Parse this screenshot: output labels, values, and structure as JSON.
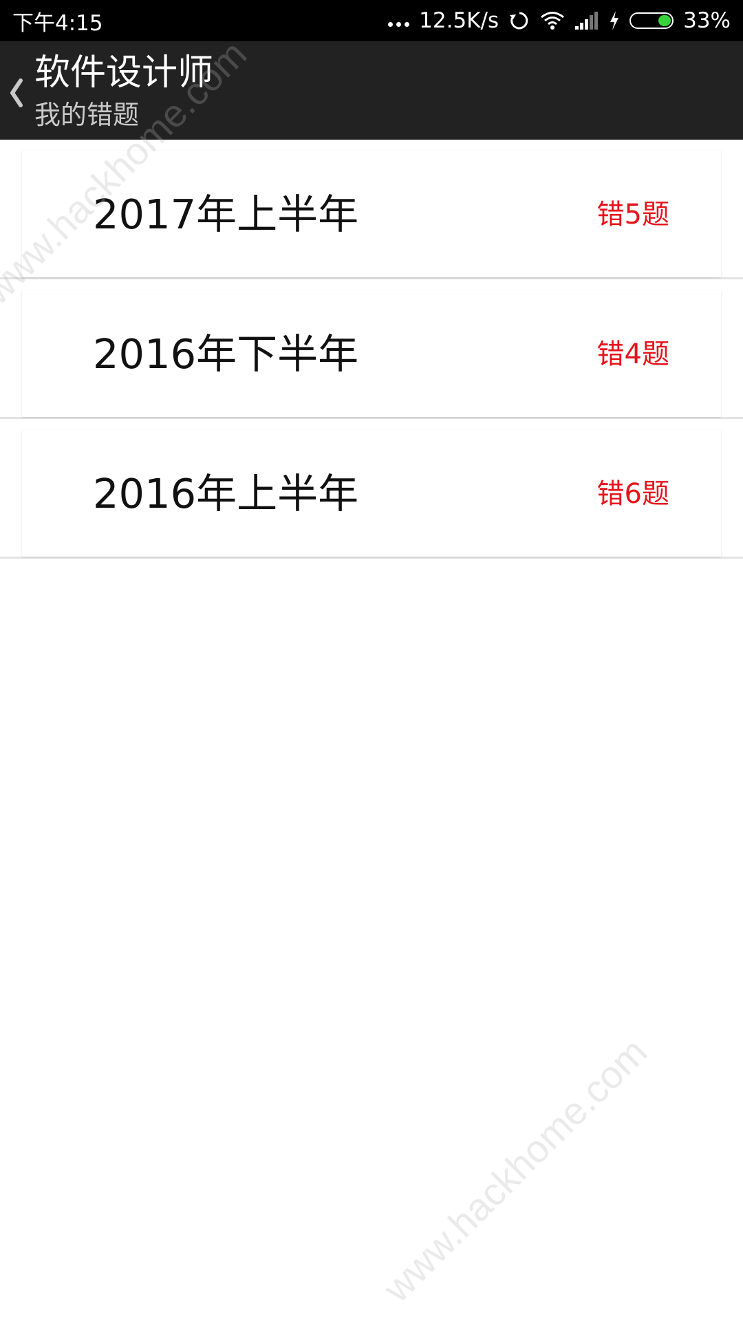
{
  "status_bar": {
    "time": "下午4:15",
    "network_speed": "12.5K/s",
    "battery_percent": "33%",
    "battery_level": 0.33,
    "icons": [
      "more-dots-icon",
      "sync-icon",
      "wifi-icon",
      "signal-icon",
      "charging-icon",
      "battery-icon"
    ]
  },
  "header": {
    "back_icon": "chevron-left-icon",
    "title": "软件设计师",
    "subtitle": "我的错题"
  },
  "items": [
    {
      "label": "2017年上半年",
      "badge": "错5题"
    },
    {
      "label": "2016年下半年",
      "badge": "错4题"
    },
    {
      "label": "2016年上半年",
      "badge": "错6题"
    }
  ],
  "colors": {
    "status_bar_bg": "#000000",
    "header_bg": "#222222",
    "badge_red": "#e8121b",
    "battery_green": "#37d33a"
  },
  "watermark": {
    "text": "www.hackhome.com"
  }
}
